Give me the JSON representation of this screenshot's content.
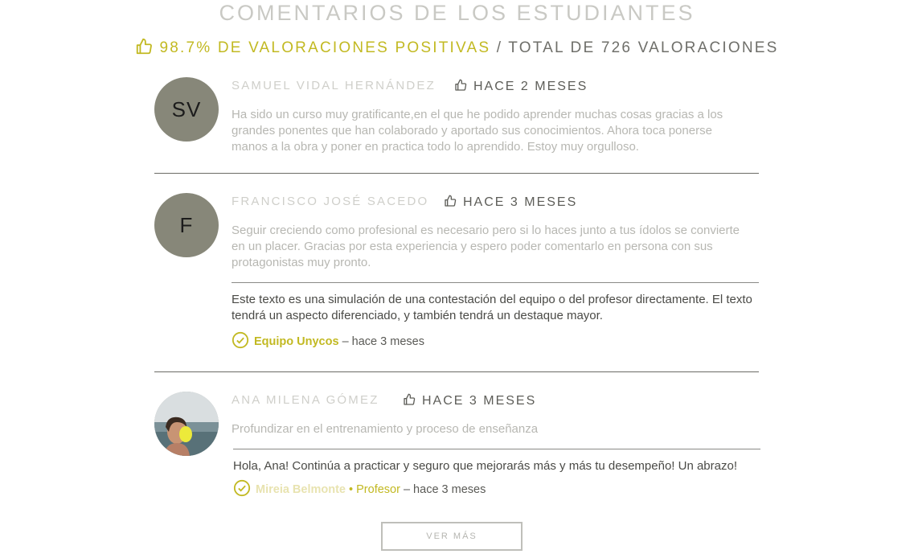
{
  "heading": "COMENTARIOS DE LOS ESTUDIANTES",
  "summary": {
    "positive": "98.7% DE VALORACIONES POSITIVAS",
    "total": "/ TOTAL DE 726 VALORACIONES"
  },
  "reviews": [
    {
      "initials": "SV",
      "name": "SAMUEL VIDAL HERNÁNDEZ",
      "time": "HACE 2 MESES",
      "text": "Ha sido un curso muy gratificante,en el que he podido aprender muchas cosas gracias a los grandes ponentes que han colaborado y aportado sus conocimientos. Ahora toca ponerse manos a la obra y poner en practica todo lo aprendido. Estoy muy orgulloso."
    },
    {
      "initials": "F",
      "name": "FRANCISCO JOSÉ SACEDO",
      "time": "HACE 3 MESES",
      "text": "Seguir creciendo como profesional es necesario pero si lo haces junto a tus ídolos se convierte en un placer. Gracias por esta experiencia y espero poder comentarlo en persona con sus protagonistas muy pronto.",
      "reply": {
        "text": "Este texto es una simulación de una contestación del equipo o del profesor directamente. El texto tendrá un aspecto diferenciado, y también tendrá un destaque mayor.",
        "author": "Equipo Unycos",
        "time": "– hace 3 meses"
      }
    },
    {
      "name": "ANA MILENA GÓMEZ",
      "time": "HACE 3 MESES",
      "text": "Profundizar en el entrenamiento y proceso de enseñanza",
      "reply": {
        "text": "Hola, Ana! Continúa a practicar y seguro que mejorarás más y más tu desempeño! Un abrazo!",
        "author": "Mireia Belmonte",
        "role": "• Profesor",
        "time": "– hace 3 meses"
      }
    }
  ],
  "more_label": "VER MÁS",
  "colors": {
    "accent": "#c2b922",
    "avatar_bg": "#878779"
  },
  "icons": [
    "thumbs-up-icon",
    "check-circle-icon"
  ]
}
